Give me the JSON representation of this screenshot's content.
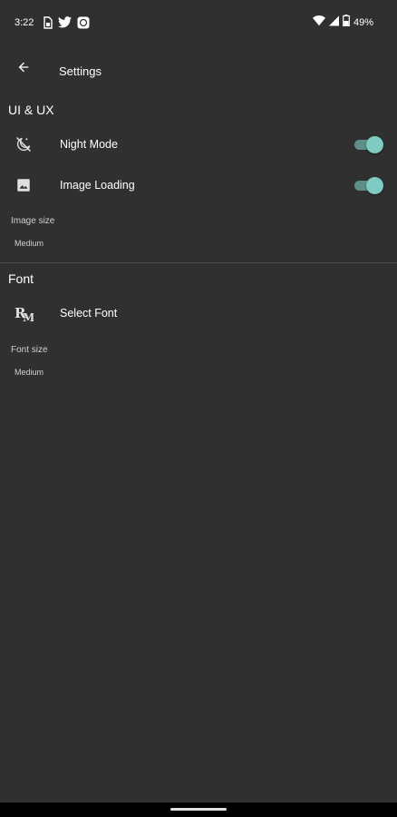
{
  "status_bar": {
    "time": "3:22",
    "battery": "49%",
    "icons_left": [
      "sim-icon",
      "twitter-icon",
      "app-notification-icon"
    ],
    "icons_right": [
      "wifi-icon",
      "signal-icon",
      "battery-icon"
    ]
  },
  "app_bar": {
    "title": "Settings",
    "back_icon": "arrow-back-icon"
  },
  "sections": {
    "ui_ux": {
      "title": "UI & UX",
      "night_mode": {
        "label": "Night Mode",
        "icon": "night-mode-icon",
        "enabled": true
      },
      "image_loading": {
        "label": "Image Loading",
        "icon": "image-icon",
        "enabled": true
      },
      "image_size": {
        "label": "Image size",
        "value": "Medium"
      }
    },
    "font": {
      "title": "Font",
      "select_font": {
        "label": "Select Font",
        "icon": "font-icon"
      },
      "font_size": {
        "label": "Font size",
        "value": "Medium"
      }
    }
  },
  "colors": {
    "background": "#303030",
    "accent": "#7fcbc1",
    "toggle_track": "#5e8f89"
  }
}
